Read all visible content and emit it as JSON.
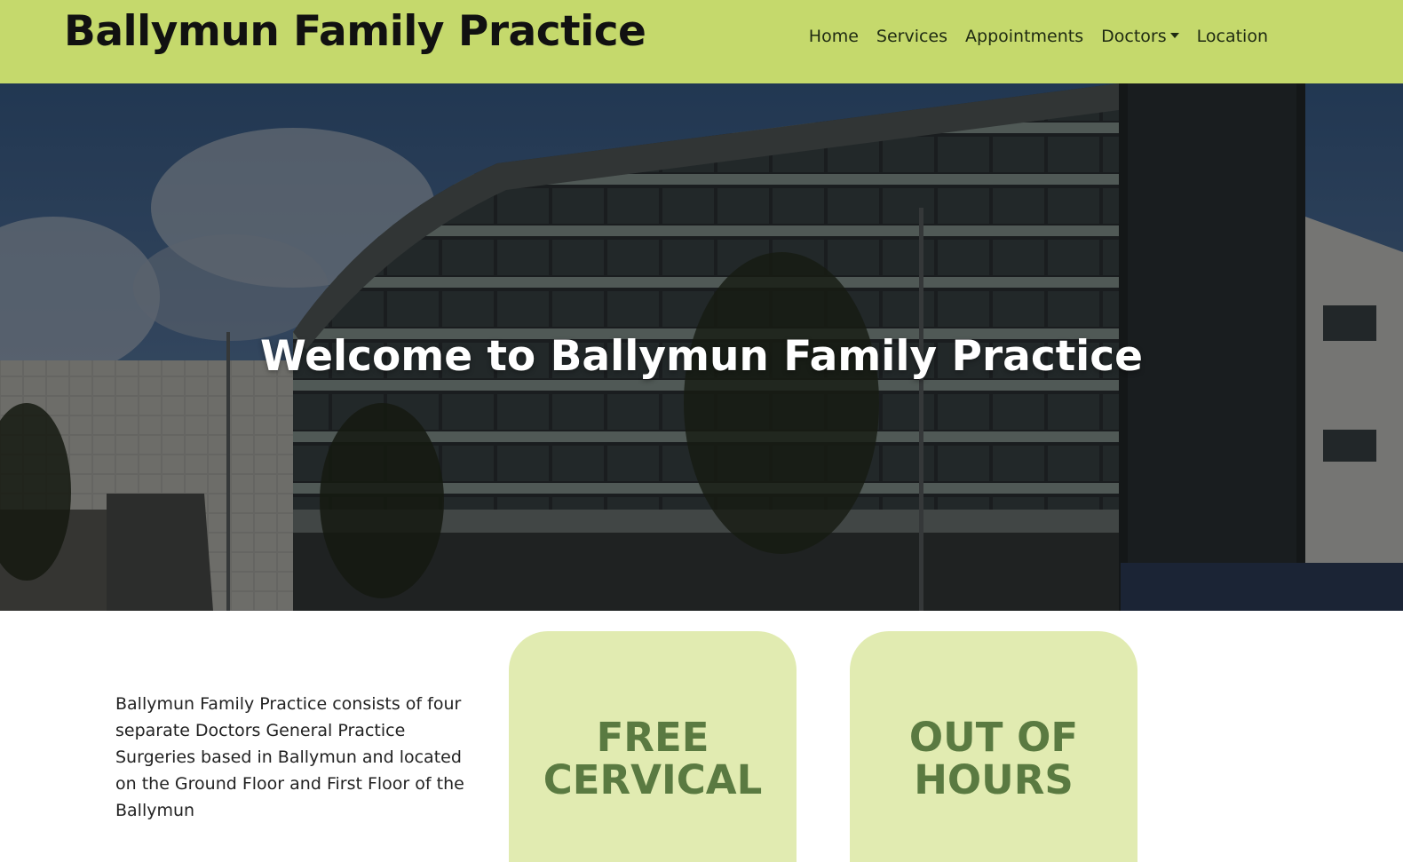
{
  "navbar": {
    "brand": "Ballymun Family Practice",
    "items": [
      {
        "label": "Home"
      },
      {
        "label": "Services"
      },
      {
        "label": "Appointments"
      },
      {
        "label": "Doctors",
        "dropdown": true
      },
      {
        "label": "Location"
      }
    ],
    "background": "#c5d96c"
  },
  "hero": {
    "heading": "Welcome to Ballymun Family Practice"
  },
  "intro": {
    "text": "Ballymun Family Practice consists of four separate Doctors General Practice Surgeries based in Ballymun and located on the Ground Floor and First Floor of the Ballymun"
  },
  "cards": [
    {
      "title": "FREE\nCERVICAL"
    },
    {
      "title": "OUT OF\nHOURS"
    }
  ],
  "colors": {
    "card_bg": "#e1ebb1",
    "card_title": "#5a7a41"
  }
}
